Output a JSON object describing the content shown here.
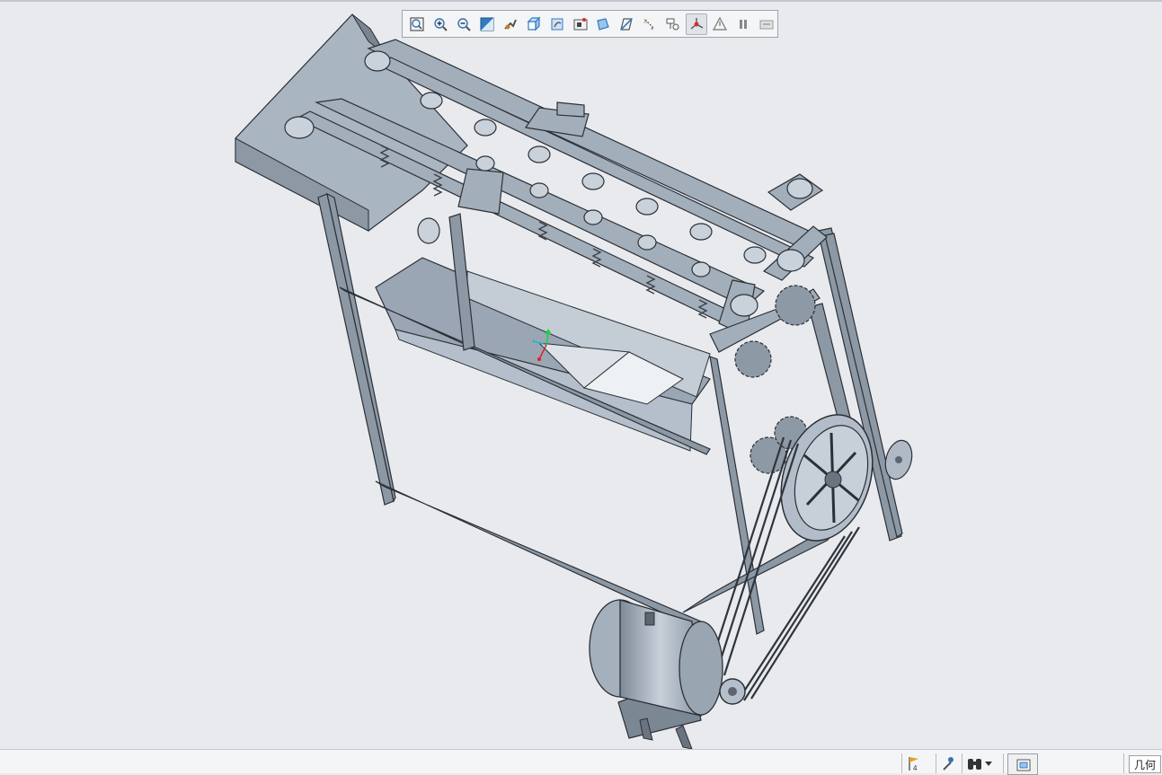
{
  "window": {
    "title": ""
  },
  "view_toolbar": {
    "buttons": [
      {
        "name": "refit-button",
        "icon": "refit-icon"
      },
      {
        "name": "zoom-in-button",
        "icon": "zoom-in-icon"
      },
      {
        "name": "zoom-out-button",
        "icon": "zoom-out-icon"
      },
      {
        "name": "repaint-button",
        "icon": "repaint-icon"
      },
      {
        "name": "pan-zoom-button",
        "icon": "pan-icon"
      },
      {
        "name": "display-style-button",
        "icon": "shaded-cube-icon"
      },
      {
        "name": "saved-orientations-button",
        "icon": "orientation-icon"
      },
      {
        "name": "view-manager-button",
        "icon": "view-manager-icon"
      },
      {
        "name": "perspective-button",
        "icon": "perspective-icon"
      },
      {
        "name": "section-button",
        "icon": "section-icon"
      },
      {
        "name": "datum-display-button",
        "icon": "datum-display-icon"
      },
      {
        "name": "annotation-display-button",
        "icon": "annotation-icon"
      },
      {
        "name": "spin-center-button",
        "icon": "spin-center-icon",
        "active": true
      },
      {
        "name": "appearance-button",
        "icon": "triangle-icon"
      },
      {
        "name": "pause-button",
        "icon": "pause-icon"
      },
      {
        "name": "hide-button",
        "icon": "hide-icon"
      }
    ]
  },
  "status_bar": {
    "flag_count": "4",
    "filter_label": "几何"
  },
  "colors": {
    "background": "#e8eaee",
    "part_fill": "#a9b4c1",
    "part_dark": "#5c6570",
    "edge": "#2b3036",
    "toolbar_bg": "#f4f5f6"
  }
}
